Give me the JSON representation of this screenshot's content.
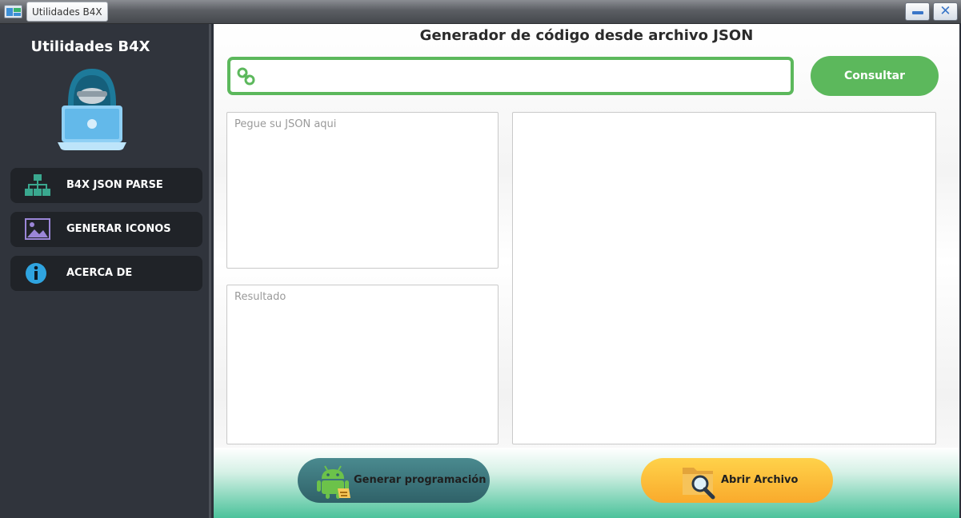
{
  "window": {
    "title": "Utilidades B4X"
  },
  "sidebar": {
    "brand": "Utilidades B4X",
    "items": [
      {
        "label": "B4X JSON PARSE",
        "icon": "sitemap-icon"
      },
      {
        "label": "GENERAR ICONOS",
        "icon": "image-icon"
      },
      {
        "label": "ACERCA DE",
        "icon": "info-icon"
      }
    ]
  },
  "main": {
    "title": "Generador de código desde archivo JSON",
    "url_input": {
      "value": "",
      "placeholder": ""
    },
    "consultar_label": "Consultar",
    "json_input": {
      "placeholder": "Pegue su JSON aqui"
    },
    "result": {
      "placeholder": "Resultado"
    },
    "output": {
      "value": ""
    },
    "generar_label": "Generar programación",
    "abrir_label": "Abrir Archivo"
  },
  "colors": {
    "accent_green": "#5cb85c",
    "sidebar_bg": "#30343c",
    "nav_item_bg": "#202328",
    "generar_button": "#2f6168",
    "abrir_button": "#f9aa2c"
  }
}
